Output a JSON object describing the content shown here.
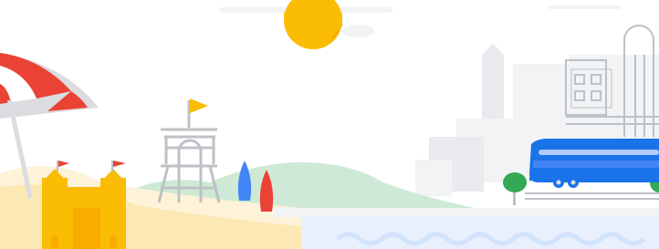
{
  "scene": {
    "description_icons": [
      "beach-umbrella-icon",
      "sandcastle-icon",
      "lifeguard-tower-icon",
      "surfboard-icon",
      "bus-icon",
      "sun-icon",
      "city-buildings-icon",
      "tree-icon",
      "waves-icon"
    ]
  },
  "colors": {
    "sun": "#FBBC04",
    "sun_shadow": "#F29900",
    "sand": "#FEF3D9",
    "sand_dark": "#FCE8B2",
    "castle": "#FBBC04",
    "castle_shade": "#F9AB00",
    "flag_red": "#EA4335",
    "umbrella_red": "#EA4335",
    "umbrella_white": "#FFFFFF",
    "umbrella_gray": "#DADCE0",
    "tower": "#BDC1C6",
    "flag_yellow": "#FBBC04",
    "surf_blue": "#4285F4",
    "surf_red": "#EA4335",
    "hill_green": "#CEEAD6",
    "building_light": "#F1F3F4",
    "building_mid": "#E8EAED",
    "building_line": "#BDC1C6",
    "bus_blue": "#1A73E8",
    "bus_light": "#4285F4",
    "bus_window": "#AECBFA",
    "tree_green": "#34A853",
    "water": "#E8F0FE",
    "wave": "#D2E3FC",
    "cloud": "#F1F3F4"
  }
}
